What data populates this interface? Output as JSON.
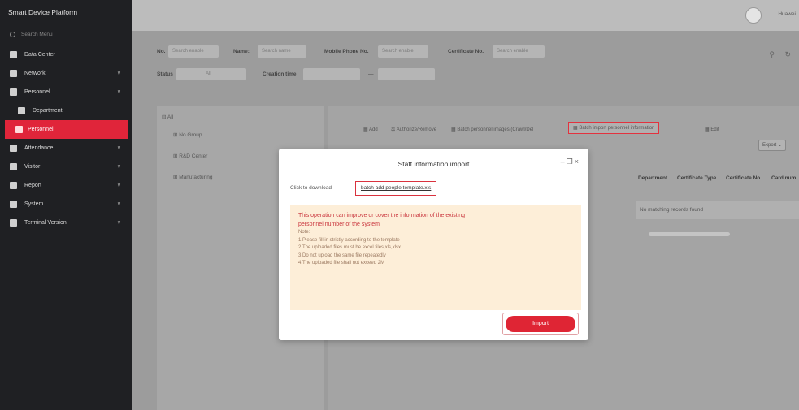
{
  "app": {
    "title": "Smart Device Platform"
  },
  "sidebar": {
    "search_placeholder": "Search Menu",
    "items": [
      {
        "label": "Data Center",
        "has_arrow": false
      },
      {
        "label": "Network",
        "has_arrow": true
      },
      {
        "label": "Personnel",
        "has_arrow": true
      },
      {
        "label": "Department",
        "has_arrow": false,
        "sub": true
      },
      {
        "label": "Personnel",
        "has_arrow": false,
        "sub": true,
        "active": true
      },
      {
        "label": "Attendance",
        "has_arrow": true
      },
      {
        "label": "Visitor",
        "has_arrow": true
      },
      {
        "label": "Report",
        "has_arrow": true
      },
      {
        "label": "System",
        "has_arrow": true
      },
      {
        "label": "Terminal Version",
        "has_arrow": true
      }
    ]
  },
  "header": {
    "username": "Huawei"
  },
  "filters": {
    "no_label": "No.",
    "no_placeholder": "Search enable",
    "name_label": "Name:",
    "name_placeholder": "Search name",
    "mobile_label": "Mobile Phone No.",
    "mobile_placeholder": "Search enable",
    "cert_label": "Certificate No.",
    "cert_placeholder": "Search enable",
    "status_label": "Status",
    "status_value": "All",
    "creation_label": "Creation time",
    "date_sep": "—"
  },
  "tree": {
    "root": "All",
    "items": [
      "No Group",
      "R&D Center",
      "Manufacturing"
    ]
  },
  "toolbar": {
    "add": "Add",
    "authorize": "Authorize/Remove",
    "batch_face": "Batch personnel images (Crawl/Del",
    "batch_import": "Batch import personnel information",
    "edit": "Edit",
    "export": "Export"
  },
  "table": {
    "columns": [
      "Department",
      "Certificate Type",
      "Certificate No.",
      "Card num"
    ],
    "empty_text": "No matching records found"
  },
  "modal": {
    "title": "Staff information import",
    "download_label": "Click to download",
    "download_link": "batch add people template.xls",
    "warning_lines": [
      "This operation can improve or cover the information of the existing",
      "personnel number of the system"
    ],
    "notes_title": "Note:",
    "notes": [
      "1.Please fill in strictly according to the template",
      "2.The uploaded files must be excel files,xls,xlsx",
      "3.Do not upload the same file repeatedly",
      "4.The uploaded file shall not exceed 2M"
    ],
    "import_label": "Import"
  }
}
